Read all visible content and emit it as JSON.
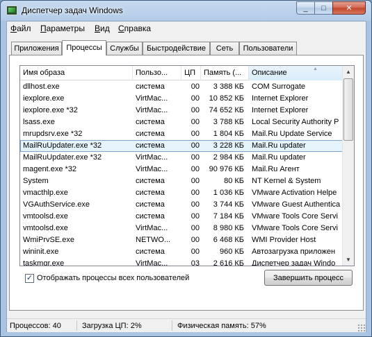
{
  "window": {
    "title": "Диспетчер задач Windows",
    "minimize_glyph": "_",
    "maximize_glyph": "□",
    "close_glyph": "✕"
  },
  "menu": [
    {
      "accel": "Ф",
      "rest": "айл"
    },
    {
      "accel": "П",
      "rest": "араметры"
    },
    {
      "accel": "В",
      "rest": "ид"
    },
    {
      "accel": "С",
      "rest": "правка"
    }
  ],
  "tabs": [
    "Приложения",
    "Процессы",
    "Службы",
    "Быстродействие",
    "Сеть",
    "Пользователи"
  ],
  "active_tab": "Процессы",
  "columns": [
    "Имя образа",
    "Пользо...",
    "ЦП",
    "Память (...",
    "Описание"
  ],
  "sorted_column": "Описание",
  "processes": [
    {
      "name": "dllhost.exe",
      "user": "система",
      "cpu": "00",
      "mem": "3 388 КБ",
      "desc": "COM Surrogate"
    },
    {
      "name": "iexplore.exe",
      "user": "VirtMac...",
      "cpu": "00",
      "mem": "10 852 КБ",
      "desc": "Internet Explorer"
    },
    {
      "name": "iexplore.exe *32",
      "user": "VirtMac...",
      "cpu": "00",
      "mem": "74 652 КБ",
      "desc": "Internet Explorer"
    },
    {
      "name": "lsass.exe",
      "user": "система",
      "cpu": "00",
      "mem": "3 788 КБ",
      "desc": "Local Security Authority P"
    },
    {
      "name": "mrupdsrv.exe *32",
      "user": "система",
      "cpu": "00",
      "mem": "1 804 КБ",
      "desc": "Mail.Ru Update Service"
    },
    {
      "name": "MailRuUpdater.exe *32",
      "user": "система",
      "cpu": "00",
      "mem": "3 228 КБ",
      "desc": "Mail.Ru updater"
    },
    {
      "name": "MailRuUpdater.exe *32",
      "user": "VirtMac...",
      "cpu": "00",
      "mem": "2 984 КБ",
      "desc": "Mail.Ru updater"
    },
    {
      "name": "magent.exe *32",
      "user": "VirtMac...",
      "cpu": "00",
      "mem": "90 976 КБ",
      "desc": "Mail.Ru Агент"
    },
    {
      "name": "System",
      "user": "система",
      "cpu": "00",
      "mem": "80 КБ",
      "desc": "NT Kernel & System"
    },
    {
      "name": "vmacthlp.exe",
      "user": "система",
      "cpu": "00",
      "mem": "1 036 КБ",
      "desc": "VMware Activation Helpe"
    },
    {
      "name": "VGAuthService.exe",
      "user": "система",
      "cpu": "00",
      "mem": "3 744 КБ",
      "desc": "VMware Guest Authentica"
    },
    {
      "name": "vmtoolsd.exe",
      "user": "система",
      "cpu": "00",
      "mem": "7 184 КБ",
      "desc": "VMware Tools Core Servi"
    },
    {
      "name": "vmtoolsd.exe",
      "user": "VirtMac...",
      "cpu": "00",
      "mem": "8 980 КБ",
      "desc": "VMware Tools Core Servi"
    },
    {
      "name": "WmiPrvSE.exe",
      "user": "NETWO...",
      "cpu": "00",
      "mem": "6 468 КБ",
      "desc": "WMI Provider Host"
    },
    {
      "name": "wininit.exe",
      "user": "система",
      "cpu": "00",
      "mem": "960 КБ",
      "desc": "Автозагрузка приложен"
    },
    {
      "name": "taskmgr.exe",
      "user": "VirtMac...",
      "cpu": "03",
      "mem": "2 616 КБ",
      "desc": "Диспетчер задач Windo"
    }
  ],
  "selected_process_index": 5,
  "show_all_users": {
    "label": "Отображать процессы всех пользователей",
    "checked": true,
    "check_glyph": "✓"
  },
  "end_process_label": "Завершить процесс",
  "status": {
    "processes": "Процессов: 40",
    "cpu": "Загрузка ЦП: 2%",
    "memory": "Физическая память: 57%"
  },
  "scroll": {
    "up_glyph": "▲",
    "down_glyph": "▼",
    "sort_glyph": "▲"
  }
}
